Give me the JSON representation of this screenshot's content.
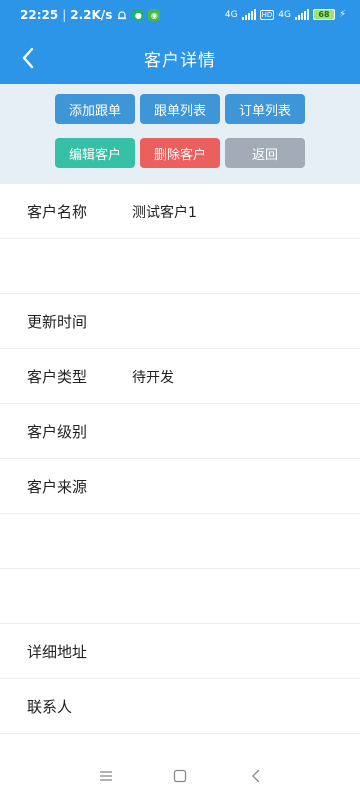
{
  "status_bar": {
    "time": "22:25",
    "speed": "2.2K/s",
    "net_1": "4G",
    "hd": "HD",
    "net_2": "4G",
    "battery": "68"
  },
  "app_bar": {
    "title": "客户详情",
    "back_icon": "chevron-left-icon"
  },
  "actions": {
    "add_follow": "添加跟单",
    "follow_list": "跟单列表",
    "order_list": "订单列表",
    "edit_customer": "编辑客户",
    "delete_customer": "删除客户",
    "back": "返回"
  },
  "fields": [
    {
      "label": "客户名称",
      "value": "测试客户1"
    },
    {
      "label": "",
      "value": ""
    },
    {
      "label": "更新时间",
      "value": ""
    },
    {
      "label": "客户类型",
      "value": "待开发"
    },
    {
      "label": "客户级别",
      "value": ""
    },
    {
      "label": "客户来源",
      "value": ""
    },
    {
      "label": "",
      "value": ""
    },
    {
      "label": "",
      "value": ""
    },
    {
      "label": "详细地址",
      "value": ""
    },
    {
      "label": "联系人",
      "value": ""
    }
  ],
  "nav_bar": {
    "icons": [
      "menu-icon",
      "home-square-icon",
      "back-triangle-icon"
    ]
  },
  "colors": {
    "primary": "#2c95e8",
    "button_blue": "#3e96d6",
    "button_teal": "#36c0a5",
    "button_red": "#ec5f5f",
    "button_gray": "#a3acb6",
    "toolbar_bg": "#e6eff5"
  }
}
